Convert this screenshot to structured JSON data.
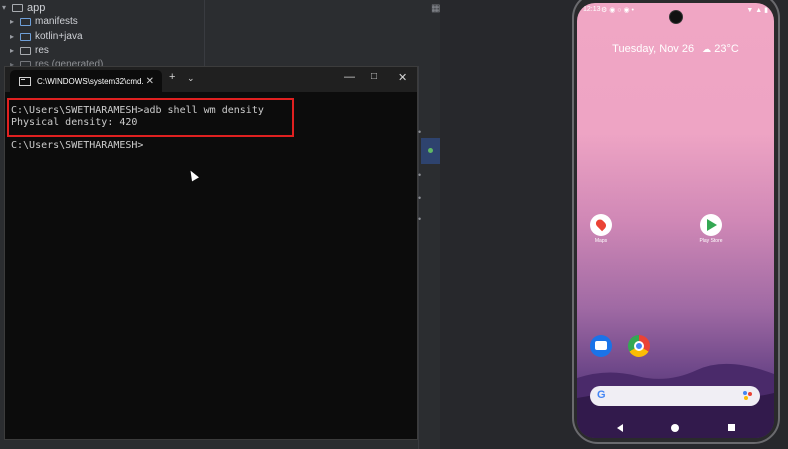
{
  "ide": {
    "tree": [
      {
        "label": "app",
        "level": 0,
        "expanded": true
      },
      {
        "label": "manifests",
        "level": 1,
        "expanded": false
      },
      {
        "label": "kotlin+java",
        "level": 1,
        "expanded": false
      },
      {
        "label": "res",
        "level": 1,
        "expanded": false
      },
      {
        "label": "res (generated)",
        "level": 1,
        "expanded": false
      }
    ]
  },
  "terminal": {
    "tab_title": "C:\\WINDOWS\\system32\\cmd.",
    "lines": [
      "C:\\Users\\SWETHARAMESH>adb shell wm density",
      "Physical density: 420",
      "",
      "C:\\Users\\SWETHARAMESH>"
    ],
    "highlight_color": "#e02020"
  },
  "phone": {
    "status_time": "12:13",
    "date": "Tuesday, Nov 26",
    "temperature": "23°C",
    "apps": [
      {
        "label": "Maps",
        "icon": "maps-icon"
      },
      {
        "label": "Play Store",
        "icon": "play-store-icon"
      },
      {
        "label": "",
        "icon": "messages-icon"
      },
      {
        "label": "",
        "icon": "chrome-icon"
      }
    ]
  }
}
